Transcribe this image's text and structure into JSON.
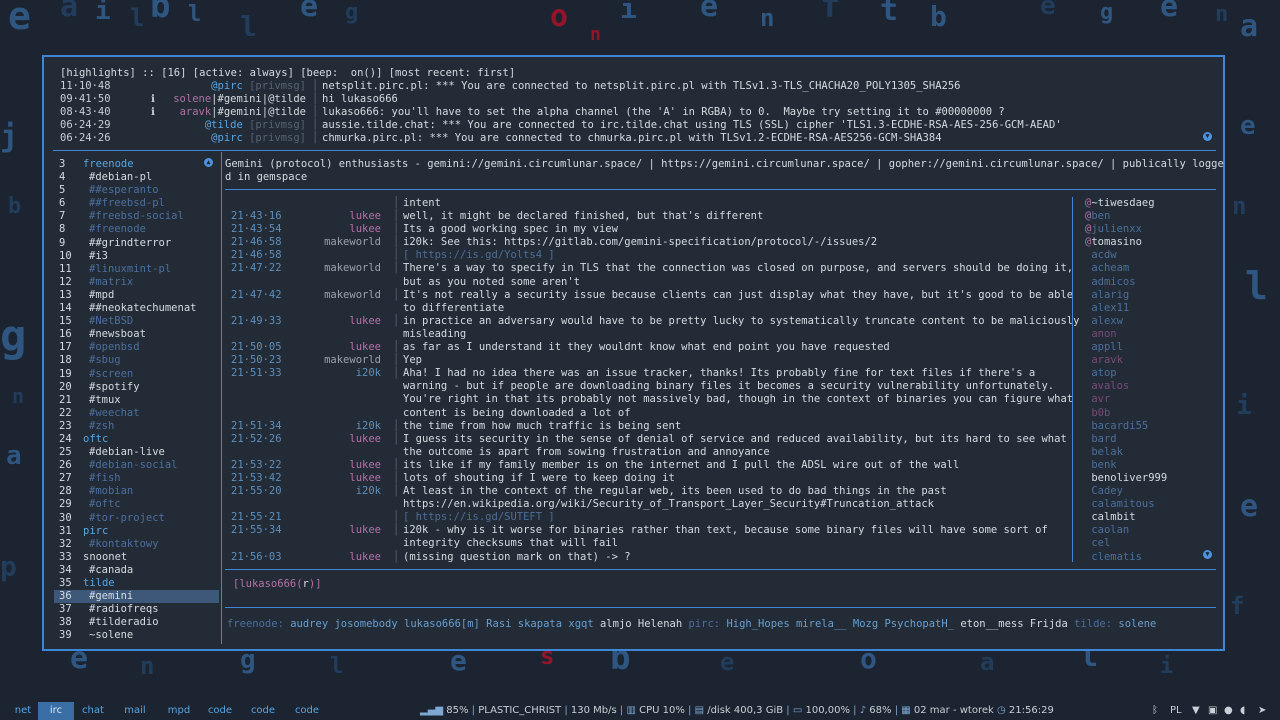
{
  "highlights": {
    "header": "[highlights] :: [16] [active: always] [beep:  on()] [most recent: first]",
    "rows": [
      {
        "time": "11·10·48",
        "info": "",
        "nick": "@pirc",
        "nick2": " [privmsg]",
        "msg": "netsplit.pirc.pl: *** You are connected to netsplit.pirc.pl with TLSv1.3-TLS_CHACHA20_POLY1305_SHA256"
      },
      {
        "time": "09·41·50",
        "info": "ℹ",
        "nick": "solene",
        "nick2": "|#gemini|@tilde",
        "msg": "hi lukaso666"
      },
      {
        "time": "08·43·40",
        "info": "ℹ",
        "nick": "aravk",
        "nick2": "|#gemini|@tilde",
        "msg": "lukaso666: you'll have to set the alpha channel (the 'A' in RGBA) to 0.  Maybe try setting it to #00000000 ?"
      },
      {
        "time": "06·24·29",
        "info": "",
        "nick": "@tilde",
        "nick2": " [privmsg]",
        "msg": "aussie.tilde.chat: *** You are connected to irc.tilde.chat using TLS (SSL) cipher 'TLS1.3-ECDHE-RSA-AES-256-GCM-AEAD'"
      },
      {
        "time": "06·24·26",
        "info": "",
        "nick": "@pirc",
        "nick2": " [privmsg]",
        "msg": "chmurka.pirc.pl: *** You are connected to chmurka.pirc.pl with TLSv1.2-ECDHE-RSA-AES256-GCM-SHA384"
      }
    ]
  },
  "buffers": [
    {
      "num": "3",
      "label": "freenode",
      "kind": "net"
    },
    {
      "num": "4",
      "label": "#debian-pl",
      "kind": "ch"
    },
    {
      "num": "5",
      "label": "##esperanto",
      "kind": "chd"
    },
    {
      "num": "6",
      "label": "##freebsd-pl",
      "kind": "chd"
    },
    {
      "num": "7",
      "label": "#freebsd-social",
      "kind": "chd"
    },
    {
      "num": "8",
      "label": "#freenode",
      "kind": "chd"
    },
    {
      "num": "9",
      "label": "##grindterror",
      "kind": "ch"
    },
    {
      "num": "10",
      "label": "#i3",
      "kind": "ch"
    },
    {
      "num": "11",
      "label": "#linuxmint-pl",
      "kind": "chd"
    },
    {
      "num": "12",
      "label": "#matrix",
      "kind": "chd"
    },
    {
      "num": "13",
      "label": "#mpd",
      "kind": "ch"
    },
    {
      "num": "14",
      "label": "##neokatechumenat",
      "kind": "ch"
    },
    {
      "num": "15",
      "label": "#NetBSD",
      "kind": "chd"
    },
    {
      "num": "16",
      "label": "#newsboat",
      "kind": "ch"
    },
    {
      "num": "17",
      "label": "#openbsd",
      "kind": "chd"
    },
    {
      "num": "18",
      "label": "#sbug",
      "kind": "chd"
    },
    {
      "num": "19",
      "label": "#screen",
      "kind": "chd"
    },
    {
      "num": "20",
      "label": "#spotify",
      "kind": "ch"
    },
    {
      "num": "21",
      "label": "#tmux",
      "kind": "ch"
    },
    {
      "num": "22",
      "label": "#weechat",
      "kind": "chd"
    },
    {
      "num": "23",
      "label": "#zsh",
      "kind": "chd"
    },
    {
      "num": "24",
      "label": "oftc",
      "kind": "net"
    },
    {
      "num": "25",
      "label": "#debian-live",
      "kind": "ch"
    },
    {
      "num": "26",
      "label": "#debian-social",
      "kind": "chd"
    },
    {
      "num": "27",
      "label": "#fish",
      "kind": "chd"
    },
    {
      "num": "28",
      "label": "#mobian",
      "kind": "chd"
    },
    {
      "num": "29",
      "label": "#oftc",
      "kind": "chd"
    },
    {
      "num": "30",
      "label": "#tor-project",
      "kind": "chd"
    },
    {
      "num": "31",
      "label": "pirc",
      "kind": "net"
    },
    {
      "num": "32",
      "label": "#kontaktowy",
      "kind": "chd"
    },
    {
      "num": "33",
      "label": "snoonet",
      "kind": "ch"
    },
    {
      "num": "34",
      "label": "#canada",
      "kind": "ch"
    },
    {
      "num": "35",
      "label": "tilde",
      "kind": "net"
    },
    {
      "num": "36",
      "label": "#gemini",
      "kind": "active"
    },
    {
      "num": "37",
      "label": "#radiofreqs",
      "kind": "ch"
    },
    {
      "num": "38",
      "label": "#tilderadio",
      "kind": "ch"
    },
    {
      "num": "39",
      "label": "~solene",
      "kind": "ch"
    }
  ],
  "title": "Gemini (protocol) enthusiasts - gemini://gemini.circumlunar.space/ | https://gemini.circumlunar.space/ | gopher://gemini.circumlunar.space/ | publically logged in gemspace",
  "chat": [
    {
      "t": "",
      "n": "",
      "c": "",
      "m": "intent"
    },
    {
      "t": "21·43·16",
      "n": "lukee",
      "c": "lukee",
      "m": "well, it might be declared finished, but that's different"
    },
    {
      "t": "21·43·54",
      "n": "lukee",
      "c": "lukee",
      "m": "Its a good working spec in my view"
    },
    {
      "t": "21·46·58",
      "n": "makeworld",
      "c": "make",
      "m": "i20k: See this: https://gitlab.com/gemini-specification/protocol/-/issues/2"
    },
    {
      "t": "21·46·58",
      "n": "",
      "c": "",
      "m": "[ https://is.gd/Yolts4 ]",
      "url": true
    },
    {
      "t": "21·47·22",
      "n": "makeworld",
      "c": "make",
      "m": "There's a way to specify in TLS that the connection was closed on purpose, and servers should be doing it, but as you noted some aren't"
    },
    {
      "t": "21·47·42",
      "n": "makeworld",
      "c": "make",
      "m": "It's not really a security issue because clients can just display what they have, but it's good to be able to differentiate"
    },
    {
      "t": "21·49·33",
      "n": "lukee",
      "c": "lukee",
      "m": "in practice an adversary would have to be pretty lucky to systematically truncate content to be maliciously misleading"
    },
    {
      "t": "21·50·05",
      "n": "lukee",
      "c": "lukee",
      "m": "as far as I understand it they wouldnt know what end point you have requested"
    },
    {
      "t": "21·50·23",
      "n": "makeworld",
      "c": "make",
      "m": "Yep"
    },
    {
      "t": "21·51·33",
      "n": "i20k",
      "c": "i20k",
      "m": "Aha! I had no idea there was an issue tracker, thanks! Its probably fine for text files if there's a warning - but if people are downloading binary files it becomes a security vulnerability unfortunately. You're right in that its probably not massively bad, though in the context of binaries you can figure what content is being downloaded a lot of"
    },
    {
      "t": "21·51·34",
      "n": "i20k",
      "c": "i20k",
      "m": "the time from how much traffic is being sent"
    },
    {
      "t": "21·52·26",
      "n": "lukee",
      "c": "lukee",
      "m": "I guess its security in the sense of denial of service and reduced availability, but its hard to see what the outcome is apart from sowing frustration and annoyance"
    },
    {
      "t": "21·53·22",
      "n": "lukee",
      "c": "lukee",
      "m": "its like if my family member is on the internet and I pull the ADSL wire out of the wall"
    },
    {
      "t": "21·53·42",
      "n": "lukee",
      "c": "lukee",
      "m": "lots of shouting if I were to keep doing it"
    },
    {
      "t": "21·55·20",
      "n": "i20k",
      "c": "i20k",
      "m": "At least in the context of the regular web, its been used to do bad things in the past https://en.wikipedia.org/wiki/Security_of_Transport_Layer_Security#Truncation_attack"
    },
    {
      "t": "21·55·21",
      "n": "",
      "c": "",
      "m": "[ https://is.gd/SUTEFT ]",
      "url": true
    },
    {
      "t": "21·55·34",
      "n": "lukee",
      "c": "lukee",
      "m": "i20k - why is it worse for binaries rather than text, because some binary files will have some sort of integrity checksums that will fail"
    },
    {
      "t": "21·56·03",
      "n": "lukee",
      "c": "lukee",
      "m": "(missing question mark on that) -> ?"
    }
  ],
  "nicks": [
    {
      "p": "@",
      "n": "~tiwesdaeg",
      "c": "#d6dbe2"
    },
    {
      "p": "@",
      "n": "ben",
      "c": "#4d6f9c"
    },
    {
      "p": "@",
      "n": "julienxx",
      "c": "#4d6f9c"
    },
    {
      "p": "@",
      "n": "tomasino",
      "c": "#d6dbe2"
    },
    {
      "p": " ",
      "n": "acdw",
      "c": "#4d6f9c"
    },
    {
      "p": " ",
      "n": "acheam",
      "c": "#4d6f9c"
    },
    {
      "p": " ",
      "n": "admicos",
      "c": "#4d6f9c"
    },
    {
      "p": " ",
      "n": "alarig",
      "c": "#4d6f9c"
    },
    {
      "p": " ",
      "n": "alex11",
      "c": "#4d6f9c"
    },
    {
      "p": " ",
      "n": "alexw",
      "c": "#4d6f9c"
    },
    {
      "p": " ",
      "n": "anon",
      "c": "#7a4a78"
    },
    {
      "p": " ",
      "n": "appll",
      "c": "#4d6f9c"
    },
    {
      "p": " ",
      "n": "aravk",
      "c": "#7a4a78"
    },
    {
      "p": " ",
      "n": "atop",
      "c": "#4d6f9c"
    },
    {
      "p": " ",
      "n": "avalos",
      "c": "#7a4a78"
    },
    {
      "p": " ",
      "n": "avr",
      "c": "#7a4a78"
    },
    {
      "p": " ",
      "n": "b0b",
      "c": "#7a4a78"
    },
    {
      "p": " ",
      "n": "bacardi55",
      "c": "#4d6f9c"
    },
    {
      "p": " ",
      "n": "bard",
      "c": "#4d6f9c"
    },
    {
      "p": " ",
      "n": "belak",
      "c": "#4d6f9c"
    },
    {
      "p": " ",
      "n": "benk",
      "c": "#4d6f9c"
    },
    {
      "p": " ",
      "n": "benoliver999",
      "c": "#d6dbe2"
    },
    {
      "p": " ",
      "n": "Cadey",
      "c": "#4d6f9c"
    },
    {
      "p": " ",
      "n": "calamitous",
      "c": "#4d6f9c"
    },
    {
      "p": " ",
      "n": "calmbit",
      "c": "#d6dbe2"
    },
    {
      "p": " ",
      "n": "caolan",
      "c": "#4d6f9c"
    },
    {
      "p": " ",
      "n": "cel",
      "c": "#4d6f9c"
    },
    {
      "p": " ",
      "n": "clematis",
      "c": "#4d6f9c"
    }
  ],
  "input": {
    "prefix": "[lukaso666(",
    "mode": "r",
    "suffix": ")]"
  },
  "status": [
    {
      "t": "freenode: ",
      "c": "#4d6f9c"
    },
    {
      "t": "audrey josomebody lukaso666[m] Rasi skapata xgqt ",
      "c": "#6a9fd1"
    },
    {
      "t": "almjo Helenah ",
      "c": "#d6dbe2"
    },
    {
      "t": "pirc: ",
      "c": "#4d6f9c"
    },
    {
      "t": "High_Hopes mirela__ Mozg PsychopatH_ ",
      "c": "#6a9fd1"
    },
    {
      "t": "eton__mess Frijda ",
      "c": "#d6dbe2"
    },
    {
      "t": "tilde: ",
      "c": "#4d6f9c"
    },
    {
      "t": "solene",
      "c": "#6a9fd1"
    }
  ],
  "workspaces": [
    "net",
    "irc",
    "chat",
    "mail",
    "mpd",
    "code",
    "code",
    "code"
  ],
  "active_workspace": "irc",
  "bar": {
    "wifi": "85%",
    "song": "PLASTIC_CHRIST",
    "net": "130 Mb/s",
    "cpu": "CPU 10%",
    "disk": "/disk 400,3 GiB",
    "battery": "100,00%",
    "volume": "68%",
    "date": "02 mar - wtorek",
    "clock": "21:56:29",
    "lang": "PL"
  }
}
